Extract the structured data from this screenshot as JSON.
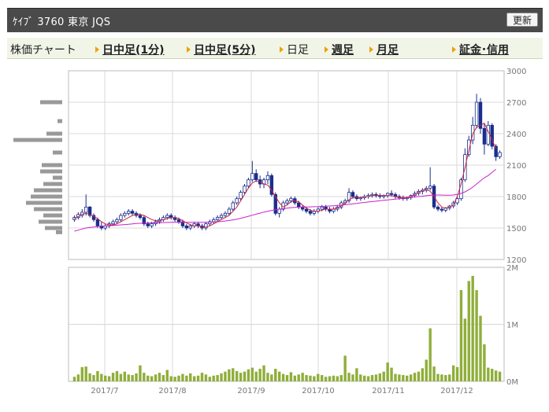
{
  "header": {
    "title": "ｹｲﾌﾞ 3760 東京 JQS",
    "refresh_label": "更新"
  },
  "nav": {
    "stock_chart_label": "株価チャート",
    "items": [
      {
        "label": "日中足(1分)",
        "link": true
      },
      {
        "label": "日中足(5分)",
        "link": true
      },
      {
        "label": "日足",
        "link": false
      },
      {
        "label": "週足",
        "link": true
      },
      {
        "label": "月足",
        "link": true
      },
      {
        "label": "証金･信用",
        "link": true
      }
    ]
  },
  "colors": {
    "up": "#1a2e8c",
    "down": "#1a2e8c",
    "ma_short": "#cc2244",
    "ma_long": "#cc22cc",
    "volume": "#8fae3a",
    "volume_profile": "#999999",
    "grid": "#d8d8d8"
  },
  "chart_data": {
    "type": "candlestick",
    "price_axis": {
      "ticks": [
        "3000",
        "2700",
        "2400",
        "2100",
        "1800",
        "1500",
        "1200"
      ],
      "min": 1200,
      "max": 3000
    },
    "volume_axis": {
      "ticks": [
        "2M",
        "1M",
        "0M"
      ],
      "min": 0,
      "max": 2000000
    },
    "x_labels": [
      "2017/7",
      "2017/8",
      "2017/9",
      "2017/10",
      "2017/11",
      "2017/12"
    ],
    "days": [
      [
        1580,
        1620,
        1560,
        1600,
        80000
      ],
      [
        1600,
        1650,
        1580,
        1630,
        120000
      ],
      [
        1620,
        1680,
        1600,
        1650,
        250000
      ],
      [
        1650,
        1820,
        1620,
        1700,
        260000
      ],
      [
        1700,
        1710,
        1600,
        1620,
        140000
      ],
      [
        1620,
        1640,
        1560,
        1580,
        110000
      ],
      [
        1580,
        1600,
        1500,
        1520,
        180000
      ],
      [
        1520,
        1560,
        1480,
        1500,
        130000
      ],
      [
        1500,
        1540,
        1480,
        1520,
        100000
      ],
      [
        1520,
        1560,
        1500,
        1540,
        90000
      ],
      [
        1540,
        1580,
        1520,
        1560,
        150000
      ],
      [
        1560,
        1600,
        1540,
        1580,
        180000
      ],
      [
        1580,
        1640,
        1560,
        1620,
        130000
      ],
      [
        1620,
        1660,
        1600,
        1640,
        170000
      ],
      [
        1640,
        1680,
        1620,
        1660,
        120000
      ],
      [
        1660,
        1680,
        1620,
        1640,
        110000
      ],
      [
        1640,
        1660,
        1600,
        1620,
        140000
      ],
      [
        1620,
        1640,
        1580,
        1600,
        280000
      ],
      [
        1600,
        1620,
        1520,
        1540,
        150000
      ],
      [
        1540,
        1560,
        1500,
        1520,
        100000
      ],
      [
        1520,
        1560,
        1500,
        1540,
        90000
      ],
      [
        1540,
        1580,
        1520,
        1560,
        120000
      ],
      [
        1560,
        1600,
        1540,
        1580,
        150000
      ],
      [
        1580,
        1620,
        1560,
        1600,
        110000
      ],
      [
        1600,
        1640,
        1580,
        1620,
        200000
      ],
      [
        1620,
        1640,
        1580,
        1600,
        90000
      ],
      [
        1600,
        1620,
        1560,
        1580,
        80000
      ],
      [
        1580,
        1600,
        1540,
        1560,
        100000
      ],
      [
        1560,
        1580,
        1500,
        1520,
        130000
      ],
      [
        1520,
        1540,
        1480,
        1500,
        100000
      ],
      [
        1500,
        1540,
        1480,
        1520,
        140000
      ],
      [
        1520,
        1560,
        1500,
        1540,
        90000
      ],
      [
        1540,
        1560,
        1500,
        1520,
        100000
      ],
      [
        1520,
        1540,
        1480,
        1500,
        150000
      ],
      [
        1500,
        1560,
        1480,
        1540,
        120000
      ],
      [
        1540,
        1580,
        1520,
        1560,
        80000
      ],
      [
        1560,
        1600,
        1540,
        1580,
        100000
      ],
      [
        1580,
        1620,
        1560,
        1600,
        110000
      ],
      [
        1600,
        1640,
        1580,
        1620,
        140000
      ],
      [
        1620,
        1660,
        1600,
        1640,
        170000
      ],
      [
        1640,
        1700,
        1620,
        1680,
        210000
      ],
      [
        1680,
        1760,
        1660,
        1740,
        230000
      ],
      [
        1740,
        1800,
        1720,
        1780,
        180000
      ],
      [
        1780,
        1860,
        1760,
        1840,
        150000
      ],
      [
        1840,
        1920,
        1820,
        1900,
        170000
      ],
      [
        1900,
        1980,
        1880,
        1960,
        210000
      ],
      [
        1960,
        2140,
        1940,
        2020,
        240000
      ],
      [
        2020,
        2060,
        1940,
        1960,
        170000
      ],
      [
        1960,
        2000,
        1880,
        1920,
        220000
      ],
      [
        1920,
        1980,
        1880,
        1960,
        280000
      ],
      [
        1960,
        2040,
        1920,
        2000,
        150000
      ],
      [
        2000,
        2020,
        1800,
        1820,
        120000
      ],
      [
        1820,
        1840,
        1620,
        1640,
        220000
      ],
      [
        1640,
        1700,
        1600,
        1680,
        170000
      ],
      [
        1680,
        1760,
        1660,
        1740,
        130000
      ],
      [
        1740,
        1780,
        1720,
        1760,
        110000
      ],
      [
        1760,
        1800,
        1740,
        1780,
        160000
      ],
      [
        1780,
        1800,
        1720,
        1740,
        100000
      ],
      [
        1740,
        1760,
        1680,
        1700,
        120000
      ],
      [
        1700,
        1720,
        1660,
        1680,
        150000
      ],
      [
        1680,
        1700,
        1640,
        1660,
        110000
      ],
      [
        1660,
        1680,
        1620,
        1640,
        100000
      ],
      [
        1640,
        1680,
        1620,
        1660,
        90000
      ],
      [
        1660,
        1700,
        1640,
        1680,
        130000
      ],
      [
        1680,
        1720,
        1660,
        1700,
        110000
      ],
      [
        1700,
        1720,
        1660,
        1680,
        80000
      ],
      [
        1680,
        1700,
        1640,
        1660,
        90000
      ],
      [
        1660,
        1700,
        1640,
        1680,
        100000
      ],
      [
        1680,
        1720,
        1660,
        1700,
        90000
      ],
      [
        1700,
        1760,
        1680,
        1740,
        110000
      ],
      [
        1740,
        1780,
        1720,
        1760,
        450000
      ],
      [
        1760,
        1880,
        1740,
        1840,
        150000
      ],
      [
        1840,
        1860,
        1780,
        1800,
        120000
      ],
      [
        1800,
        1820,
        1760,
        1780,
        230000
      ],
      [
        1780,
        1800,
        1760,
        1790,
        120000
      ],
      [
        1790,
        1820,
        1770,
        1800,
        100000
      ],
      [
        1800,
        1830,
        1780,
        1810,
        90000
      ],
      [
        1810,
        1840,
        1790,
        1820,
        110000
      ],
      [
        1820,
        1840,
        1790,
        1810,
        120000
      ],
      [
        1810,
        1830,
        1780,
        1800,
        140000
      ],
      [
        1800,
        1820,
        1780,
        1810,
        170000
      ],
      [
        1810,
        1840,
        1790,
        1830,
        330000
      ],
      [
        1830,
        1860,
        1800,
        1820,
        240000
      ],
      [
        1820,
        1840,
        1780,
        1800,
        130000
      ],
      [
        1800,
        1820,
        1770,
        1790,
        120000
      ],
      [
        1790,
        1810,
        1760,
        1780,
        110000
      ],
      [
        1780,
        1800,
        1760,
        1790,
        100000
      ],
      [
        1790,
        1820,
        1770,
        1810,
        120000
      ],
      [
        1810,
        1850,
        1790,
        1830,
        150000
      ],
      [
        1830,
        1870,
        1810,
        1850,
        170000
      ],
      [
        1850,
        1880,
        1820,
        1860,
        230000
      ],
      [
        1860,
        1900,
        1840,
        1880,
        380000
      ],
      [
        1880,
        2080,
        1860,
        1900,
        930000
      ],
      [
        1900,
        1920,
        1680,
        1700,
        260000
      ],
      [
        1700,
        1720,
        1660,
        1680,
        130000
      ],
      [
        1680,
        1700,
        1650,
        1670,
        120000
      ],
      [
        1670,
        1700,
        1650,
        1690,
        110000
      ],
      [
        1690,
        1720,
        1670,
        1710,
        120000
      ],
      [
        1710,
        1760,
        1690,
        1740,
        280000
      ],
      [
        1740,
        1800,
        1720,
        1780,
        250000
      ],
      [
        1780,
        1980,
        1760,
        1960,
        1600000
      ],
      [
        1960,
        2260,
        1940,
        2200,
        1100000
      ],
      [
        2200,
        2380,
        2180,
        2340,
        1760000
      ],
      [
        2340,
        2560,
        2300,
        2480,
        1850000
      ],
      [
        2480,
        2780,
        2450,
        2700,
        1600000
      ],
      [
        2700,
        2740,
        2400,
        2450,
        1150000
      ],
      [
        2450,
        2500,
        2200,
        2300,
        650000
      ],
      [
        2300,
        2520,
        2280,
        2480,
        240000
      ],
      [
        2480,
        2500,
        2250,
        2280,
        220000
      ],
      [
        2280,
        2300,
        2140,
        2180,
        190000
      ],
      [
        2180,
        2240,
        2160,
        2220,
        170000
      ]
    ],
    "ma_short": [
      1590,
      1610,
      1630,
      1640,
      1630,
      1610,
      1590,
      1560,
      1540,
      1530,
      1530,
      1540,
      1560,
      1580,
      1600,
      1620,
      1630,
      1630,
      1620,
      1600,
      1580,
      1570,
      1570,
      1580,
      1590,
      1600,
      1600,
      1590,
      1570,
      1550,
      1530,
      1520,
      1520,
      1510,
      1510,
      1520,
      1540,
      1560,
      1580,
      1600,
      1620,
      1660,
      1700,
      1760,
      1820,
      1880,
      1930,
      1950,
      1940,
      1920,
      1910,
      1860,
      1800,
      1740,
      1700,
      1720,
      1750,
      1760,
      1750,
      1720,
      1690,
      1670,
      1660,
      1660,
      1670,
      1680,
      1680,
      1680,
      1690,
      1710,
      1740,
      1770,
      1790,
      1790,
      1790,
      1800,
      1800,
      1810,
      1810,
      1810,
      1810,
      1810,
      1810,
      1800,
      1790,
      1790,
      1790,
      1800,
      1820,
      1840,
      1860,
      1870,
      1850,
      1800,
      1740,
      1700,
      1690,
      1700,
      1720,
      1800,
      1920,
      2080,
      2240,
      2400,
      2460,
      2480,
      2500,
      2420,
      2340,
      2260
    ],
    "ma_long": [
      1470,
      1480,
      1490,
      1500,
      1505,
      1510,
      1515,
      1518,
      1520,
      1522,
      1525,
      1527,
      1530,
      1533,
      1536,
      1540,
      1543,
      1545,
      1547,
      1548,
      1549,
      1550,
      1551,
      1552,
      1553,
      1554,
      1555,
      1555,
      1555,
      1555,
      1555,
      1555,
      1555,
      1555,
      1555,
      1556,
      1558,
      1560,
      1563,
      1567,
      1572,
      1578,
      1585,
      1593,
      1602,
      1612,
      1622,
      1632,
      1642,
      1652,
      1660,
      1668,
      1674,
      1680,
      1685,
      1690,
      1694,
      1697,
      1699,
      1700,
      1701,
      1702,
      1703,
      1704,
      1706,
      1708,
      1710,
      1712,
      1715,
      1718,
      1722,
      1726,
      1730,
      1735,
      1740,
      1744,
      1748,
      1752,
      1756,
      1760,
      1764,
      1768,
      1772,
      1776,
      1780,
      1784,
      1788,
      1792,
      1796,
      1800,
      1804,
      1808,
      1812,
      1815,
      1815,
      1814,
      1813,
      1813,
      1815,
      1820,
      1830,
      1845,
      1865,
      1890,
      1920,
      1950,
      1980,
      2000,
      2030,
      2060
    ],
    "volume_profile": [
      [
        2700,
        28
      ],
      [
        2520,
        6
      ],
      [
        2400,
        20
      ],
      [
        2340,
        62
      ],
      [
        2220,
        12
      ],
      [
        2100,
        26
      ],
      [
        2040,
        28
      ],
      [
        1980,
        12
      ],
      [
        1920,
        24
      ],
      [
        1860,
        36
      ],
      [
        1800,
        40
      ],
      [
        1740,
        46
      ],
      [
        1680,
        36
      ],
      [
        1620,
        24
      ],
      [
        1560,
        30
      ],
      [
        1500,
        22
      ],
      [
        1460,
        8
      ]
    ]
  }
}
